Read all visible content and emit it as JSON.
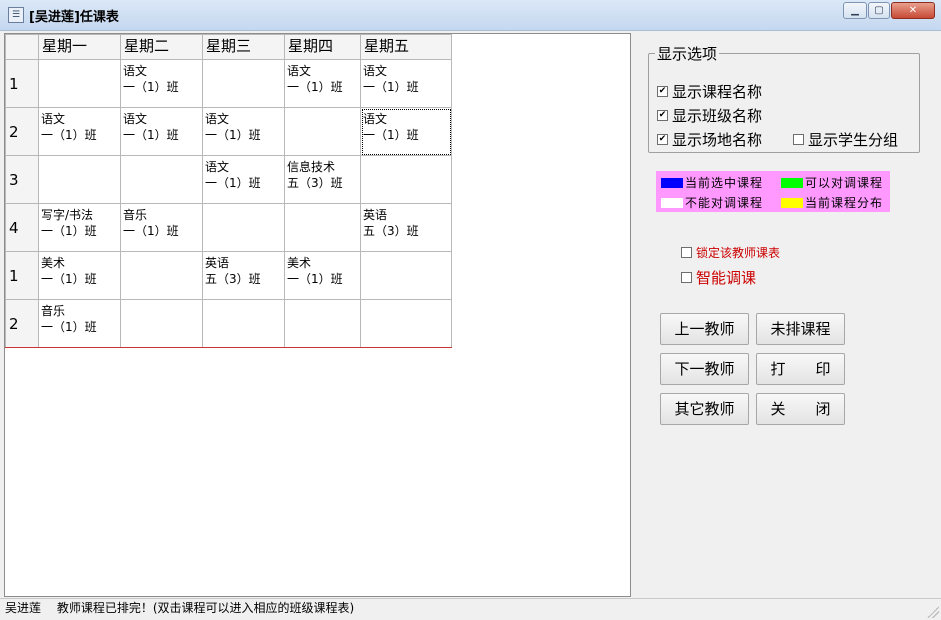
{
  "window": {
    "title": "[吴进莲]任课表"
  },
  "schedule": {
    "headers": [
      "星期一",
      "星期二",
      "星期三",
      "星期四",
      "星期五"
    ],
    "rows": [
      {
        "label": "1",
        "cells": [
          [],
          [
            "语文",
            "一（1）班"
          ],
          [],
          [
            "语文",
            "一（1）班"
          ],
          [
            "语文",
            "一（1）班"
          ]
        ]
      },
      {
        "label": "2",
        "cells": [
          [
            "语文",
            "一（1）班"
          ],
          [
            "语文",
            "一（1）班"
          ],
          [
            "语文",
            "一（1）班"
          ],
          [],
          [
            "语文",
            "一（1）班"
          ]
        ]
      },
      {
        "label": "3",
        "cells": [
          [],
          [],
          [
            "语文",
            "一（1）班"
          ],
          [
            "信息技术",
            "五（3）班"
          ],
          []
        ]
      },
      {
        "label": "4",
        "cells": [
          [
            "写字/书法",
            "一（1）班"
          ],
          [
            "音乐",
            "一（1）班"
          ],
          [],
          [],
          [
            "英语",
            "五（3）班"
          ]
        ]
      },
      {
        "label": "1",
        "cells": [
          [
            "美术",
            "一（1）班"
          ],
          [],
          [
            "英语",
            "五（3）班"
          ],
          [
            "美术",
            "一（1）班"
          ],
          []
        ]
      },
      {
        "label": "2",
        "cells": [
          [
            "音乐",
            "一（1）班"
          ],
          [],
          [],
          [],
          []
        ]
      }
    ]
  },
  "options": {
    "legend": "显示选项",
    "show_course": "显示课程名称",
    "show_class": "显示班级名称",
    "show_venue": "显示场地名称",
    "show_group": "显示学生分组",
    "show_course_checked": true,
    "show_class_checked": true,
    "show_venue_checked": true,
    "show_group_checked": false
  },
  "legend": {
    "current": "当前选中课程",
    "swappable": "可以对调课程",
    "not_swappable": "不能对调课程",
    "distribution": "当前课程分布",
    "colors": {
      "current": "#0000ff",
      "swappable": "#00ff00",
      "not_swappable": "#ffffff",
      "distribution": "#ffff00",
      "background": "#ff99ff"
    }
  },
  "locks": {
    "lock_teacher": "锁定该教师课表",
    "smart_adjust": "智能调课"
  },
  "buttons": {
    "prev_teacher": "上一教师",
    "unscheduled": "未排课程",
    "next_teacher": "下一教师",
    "print": "打　　印",
    "other_teacher": "其它教师",
    "close": "关　　闭"
  },
  "status": {
    "name": "吴进莲",
    "message": "教师课程已排完！(双击课程可以进入相应的班级课程表)"
  }
}
